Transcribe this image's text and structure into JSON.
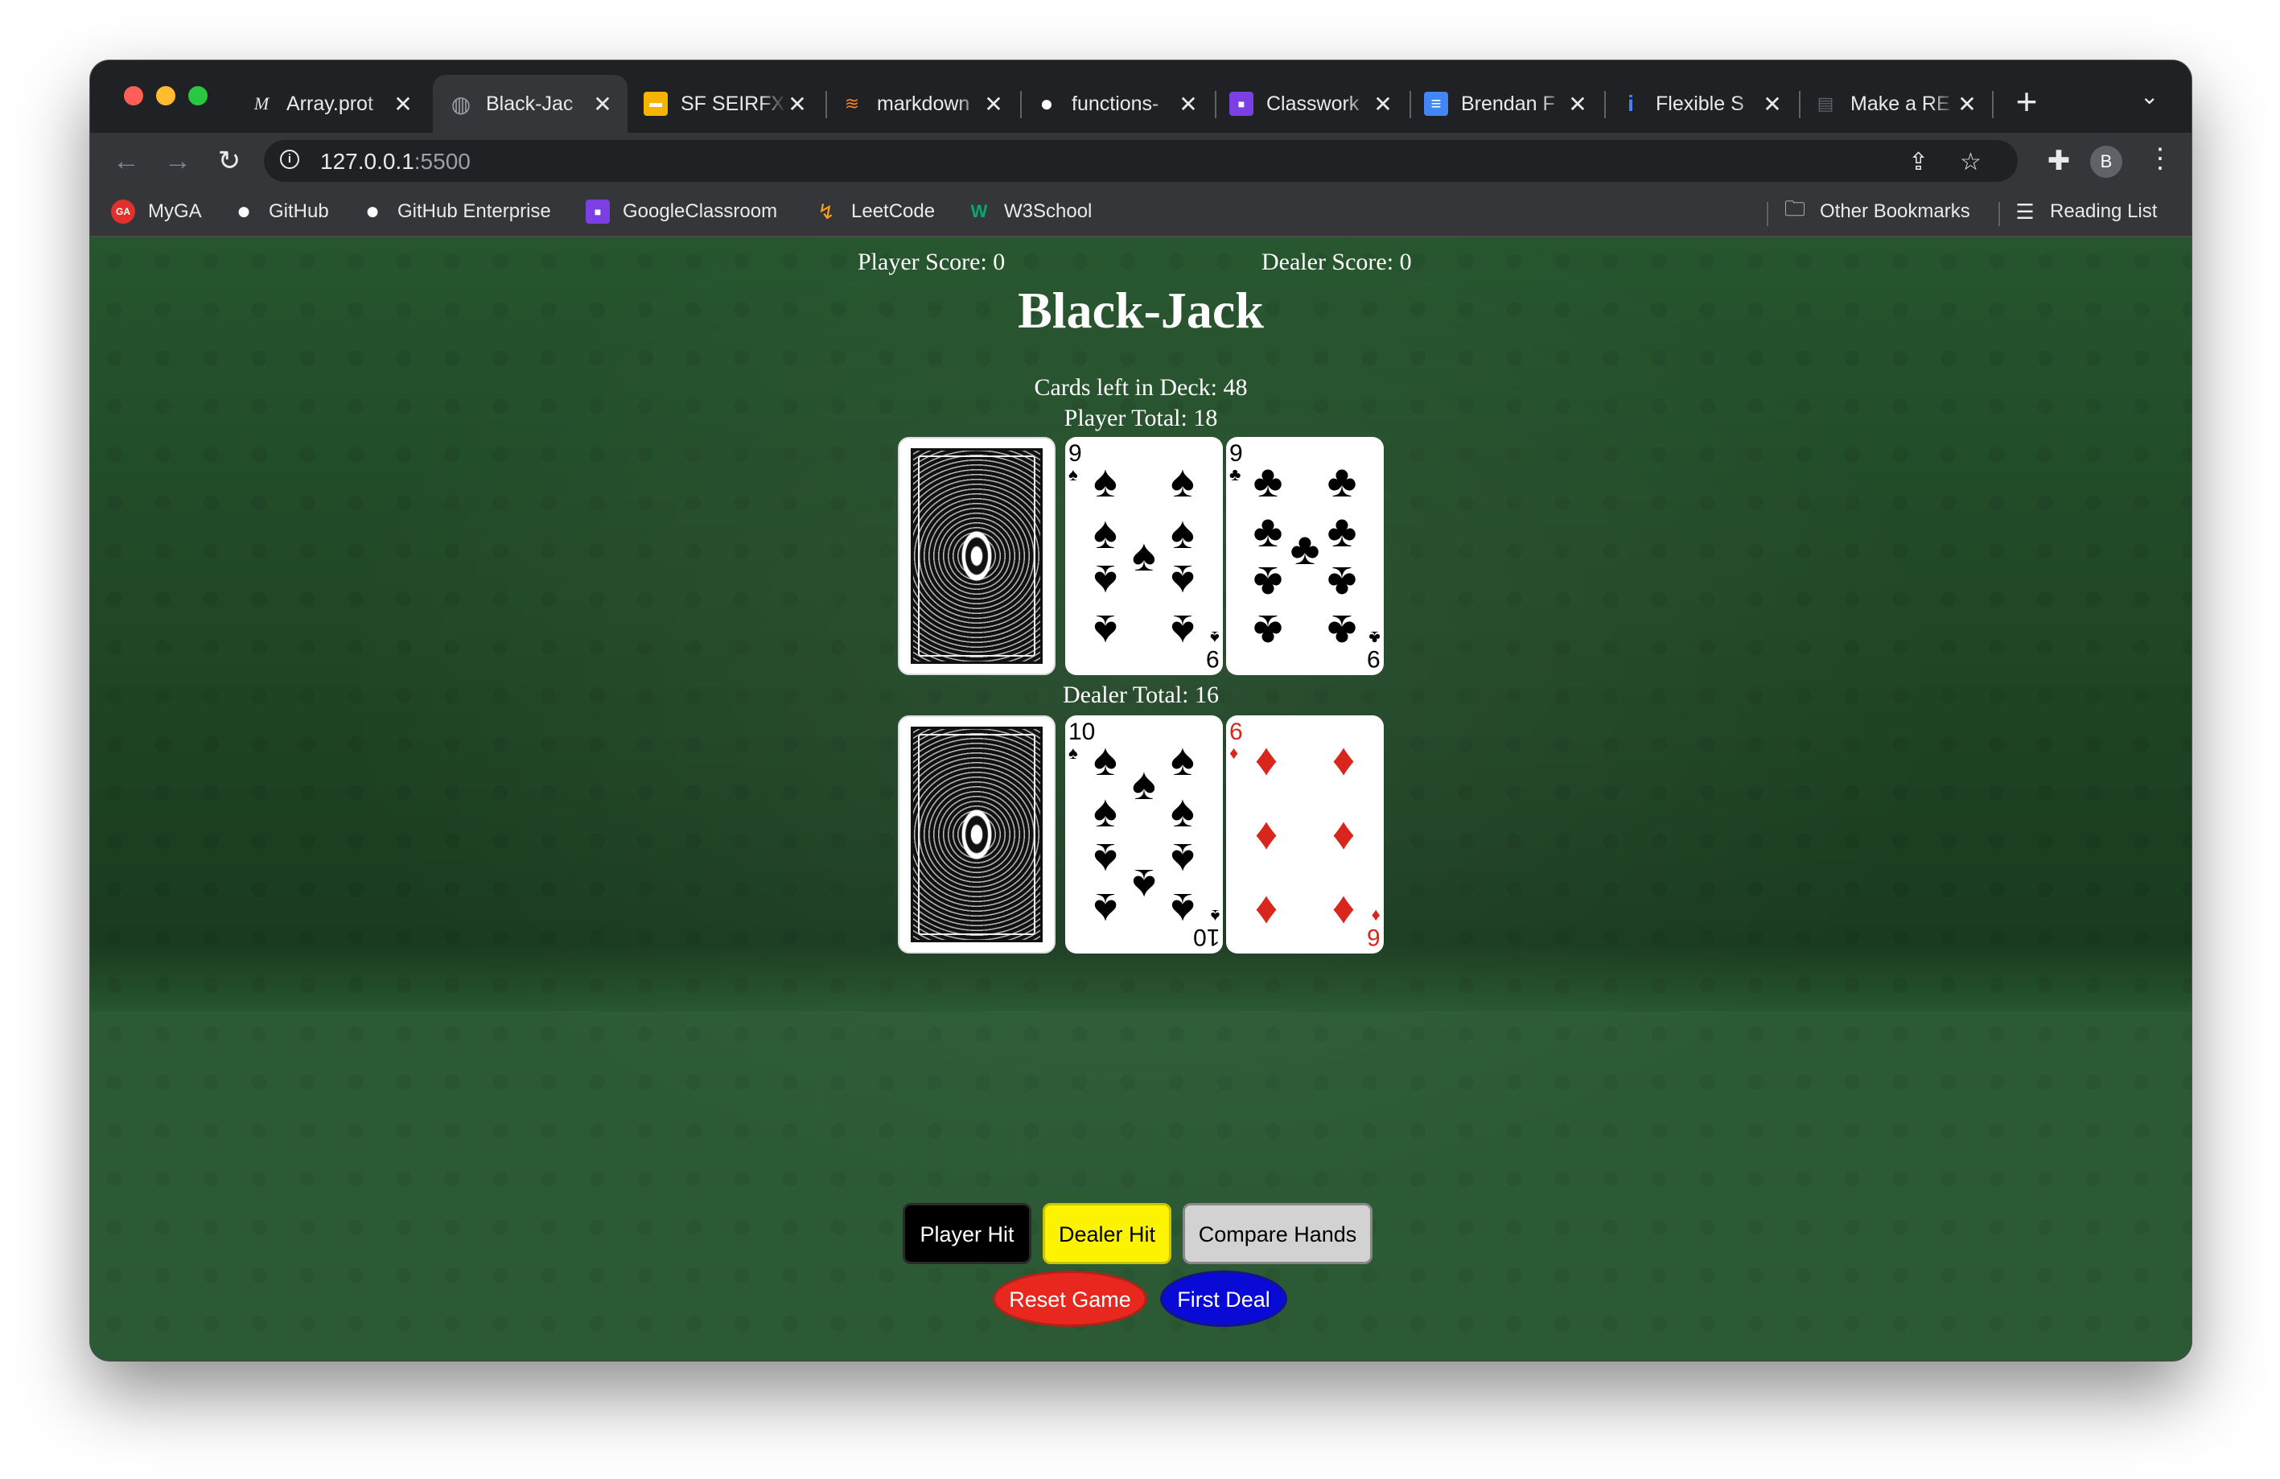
{
  "browser": {
    "tabs": [
      {
        "title": "Array.prot",
        "favicon": "mdn-icon",
        "glyph": "M",
        "active": false
      },
      {
        "title": "Black-Jac",
        "favicon": "globe-icon",
        "glyph": "◍",
        "active": true
      },
      {
        "title": "SF SEIRFX",
        "favicon": "slides-icon",
        "glyph": "▬",
        "active": false
      },
      {
        "title": "markdown",
        "favicon": "stackoverflow-icon",
        "glyph": "≋",
        "active": false
      },
      {
        "title": "functions-",
        "favicon": "github-icon",
        "glyph": "●",
        "active": false
      },
      {
        "title": "Classwork",
        "favicon": "classroom-icon",
        "glyph": "■",
        "active": false
      },
      {
        "title": "Brendan F",
        "favicon": "docs-icon",
        "glyph": "≡",
        "active": false
      },
      {
        "title": "Flexible S",
        "favicon": "info-icon",
        "glyph": "i",
        "active": false
      },
      {
        "title": "Make a RE",
        "favicon": "doc-icon",
        "glyph": "▤",
        "active": false
      }
    ],
    "close_glyph": "✕",
    "new_tab_glyph": "+",
    "tab_search_glyph": "⌄",
    "nav": {
      "back": "←",
      "forward": "→",
      "reload": "↻"
    },
    "url": {
      "host": "127.0.0.1",
      "port": ":5500"
    },
    "omnibox_info_glyph": "i",
    "share_glyph": "⇪",
    "star_glyph": "☆",
    "extensions_glyph": "✚",
    "avatar_letter": "B",
    "menu_glyph": "⋮",
    "bookmarks": [
      {
        "label": "MyGA",
        "icon": "ga-icon",
        "glyph": "GA"
      },
      {
        "label": "GitHub",
        "icon": "github-icon",
        "glyph": "●"
      },
      {
        "label": "GitHub Enterprise",
        "icon": "github-icon",
        "glyph": "●"
      },
      {
        "label": "GoogleClassroom",
        "icon": "classroom-icon",
        "glyph": "■"
      },
      {
        "label": "LeetCode",
        "icon": "leetcode-icon",
        "glyph": "↯"
      },
      {
        "label": "W3School",
        "icon": "w3schools-icon",
        "glyph": "W"
      }
    ],
    "other_bookmarks": {
      "label": "Other Bookmarks",
      "glyph": "🗀"
    },
    "reading_list": {
      "label": "Reading List",
      "glyph": "☰"
    }
  },
  "game": {
    "player_score": "Player Score: 0",
    "dealer_score": "Dealer Score: 0",
    "title": "Black-Jack",
    "cards_left": "Cards left in Deck: 48",
    "player_total": "Player Total: 18",
    "dealer_total": "Dealer Total: 16",
    "player_cards": [
      {
        "face": "back"
      },
      {
        "face": "up",
        "rank": "9",
        "suit": "♠",
        "color": "black"
      },
      {
        "face": "up",
        "rank": "9",
        "suit": "♣",
        "color": "black"
      }
    ],
    "dealer_cards": [
      {
        "face": "back"
      },
      {
        "face": "up",
        "rank": "10",
        "suit": "♠",
        "color": "black"
      },
      {
        "face": "up",
        "rank": "6",
        "suit": "♦",
        "color": "red"
      }
    ],
    "buttons": {
      "player_hit": "Player Hit",
      "dealer_hit": "Dealer Hit",
      "compare": "Compare Hands",
      "reset": "Reset Game",
      "first_deal": "First Deal"
    },
    "colors": {
      "felt": "#285a30",
      "player_hit_bg": "#000000",
      "dealer_hit_bg": "#fcf300",
      "compare_bg": "#d2d2d2",
      "reset_bg": "#e8271f",
      "deal_bg": "#0a0ad6"
    }
  }
}
